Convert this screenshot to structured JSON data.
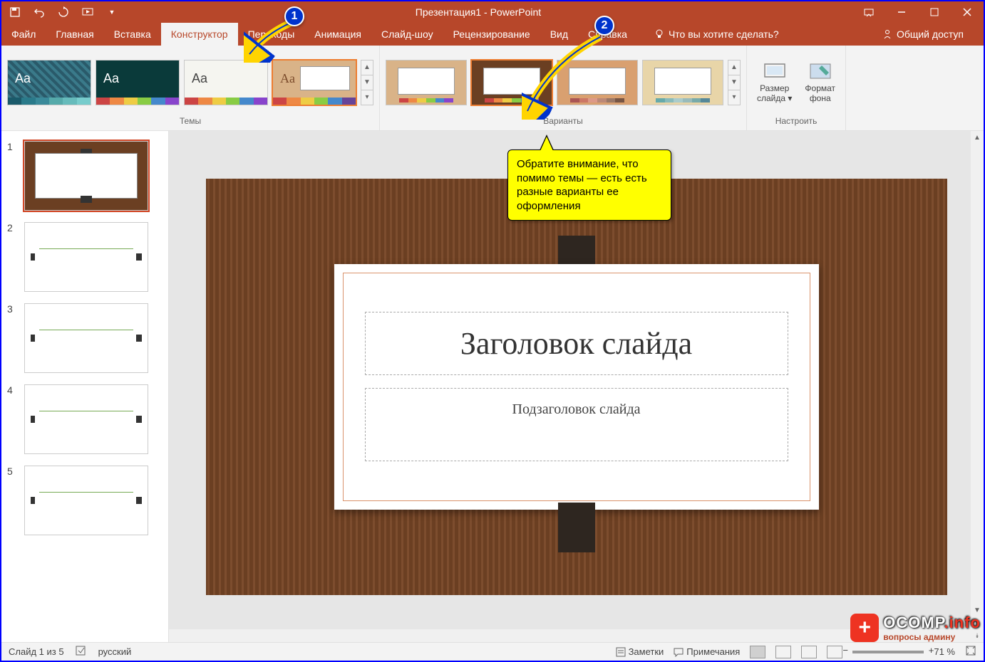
{
  "title": "Презентация1 - PowerPoint",
  "qat": {
    "save": "save-icon",
    "undo": "undo-icon",
    "redo": "redo-icon",
    "start": "start-from-beginning-icon"
  },
  "window": {
    "minimize": "−",
    "maximize": "□",
    "close": "✕",
    "ribbon_opts": "▭"
  },
  "tabs": {
    "file": "Файл",
    "home": "Главная",
    "insert": "Вставка",
    "design": "Конструктор",
    "transitions": "Переходы",
    "animations": "Анимация",
    "slideshow": "Слайд-шоу",
    "review": "Рецензирование",
    "view": "Вид",
    "help": "Справка"
  },
  "tell_me": "Что вы хотите сделать?",
  "share": "Общий доступ",
  "ribbon": {
    "themes_label": "Темы",
    "variants_label": "Варианты",
    "customize_label": "Настроить",
    "slide_size": "Размер\nслайда",
    "format_bg": "Формат\nфона",
    "slide_size_line1": "Размер",
    "slide_size_line2": "слайда",
    "format_bg_line1": "Формат",
    "format_bg_line2": "фона"
  },
  "thumbnails": [
    {
      "num": "1"
    },
    {
      "num": "2"
    },
    {
      "num": "3"
    },
    {
      "num": "4"
    },
    {
      "num": "5"
    }
  ],
  "slide": {
    "title_placeholder": "Заголовок слайда",
    "subtitle_placeholder": "Подзаголовок слайда"
  },
  "callout": "Обратите внимание, что помимо темы — есть есть разные варианты ее оформления",
  "badges": {
    "one": "1",
    "two": "2"
  },
  "status": {
    "slide_count": "Слайд 1 из 5",
    "language": "русский",
    "notes": "Заметки",
    "comments": "Примечания",
    "zoom": "71 %"
  },
  "watermark": {
    "main": "OCOMP",
    "suffix": ".info",
    "sub": "вопросы админу"
  },
  "user_faded": ""
}
